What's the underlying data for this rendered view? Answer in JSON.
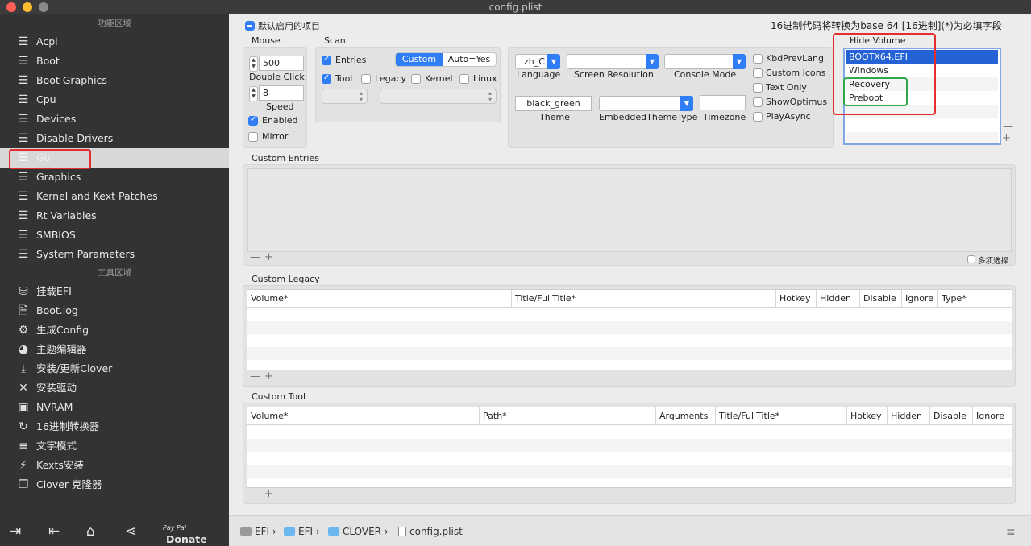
{
  "window": {
    "title": "config.plist"
  },
  "colors": {
    "accent": "#2f7ef6",
    "sidebar_bg": "#333333",
    "highlight_red": "#e52d2d",
    "highlight_green": "#2ea84a"
  },
  "sidebar": {
    "section1": "功能区域",
    "items": [
      {
        "label": "Acpi",
        "icon": "list-icon"
      },
      {
        "label": "Boot",
        "icon": "list-icon"
      },
      {
        "label": "Boot Graphics",
        "icon": "list-icon"
      },
      {
        "label": "Cpu",
        "icon": "list-icon"
      },
      {
        "label": "Devices",
        "icon": "list-icon"
      },
      {
        "label": "Disable Drivers",
        "icon": "list-icon"
      },
      {
        "label": "Gui",
        "icon": "list-icon",
        "selected": true
      },
      {
        "label": "Graphics",
        "icon": "list-icon"
      },
      {
        "label": "Kernel and Kext Patches",
        "icon": "list-icon"
      },
      {
        "label": "Rt Variables",
        "icon": "list-icon"
      },
      {
        "label": "SMBIOS",
        "icon": "list-icon"
      },
      {
        "label": "System Parameters",
        "icon": "list-icon"
      }
    ],
    "section2": "工具区域",
    "tools": [
      {
        "label": "挂载EFI",
        "icon": "disk-icon"
      },
      {
        "label": "Boot.log",
        "icon": "log-icon"
      },
      {
        "label": "生成Config",
        "icon": "gears-icon"
      },
      {
        "label": "主题编辑器",
        "icon": "palette-icon"
      },
      {
        "label": "安装/更新Clover",
        "icon": "download-icon"
      },
      {
        "label": "安装驱动",
        "icon": "tools-icon"
      },
      {
        "label": "NVRAM",
        "icon": "chip-icon"
      },
      {
        "label": "16进制转换器",
        "icon": "refresh-icon"
      },
      {
        "label": "文字模式",
        "icon": "text-icon"
      },
      {
        "label": "Kexts安装",
        "icon": "plug-icon"
      },
      {
        "label": "Clover 克隆器",
        "icon": "copy-icon"
      }
    ],
    "bottom": {
      "paypal": "Pay Pal",
      "donate": "Donate"
    }
  },
  "main": {
    "default_items_label": "默认启用的项目",
    "hint": "16进制代码将转换为base 64 [16进制](*)为必填字段",
    "mouse": {
      "title": "Mouse",
      "double_click_value": "500",
      "double_click_label": "Double Click",
      "speed_value": "8",
      "speed_label": "Speed",
      "enabled_label": "Enabled",
      "mirror_label": "Mirror"
    },
    "scan": {
      "title": "Scan",
      "entries": "Entries",
      "seg_custom": "Custom",
      "seg_auto": "Auto=Yes",
      "tool": "Tool",
      "legacy": "Legacy",
      "kernel": "Kernel",
      "linux": "Linux"
    },
    "gui": {
      "language_value": "zh_C",
      "language_label": "Language",
      "screen_resolution_label": "Screen Resolution",
      "console_mode_label": "Console Mode",
      "theme_value": "black_green",
      "theme_label": "Theme",
      "embedded_theme_label": "EmbeddedThemeType",
      "timezone_label": "Timezone",
      "kbd_prev_lang": "KbdPrevLang",
      "custom_icons": "Custom Icons",
      "text_only": "Text Only",
      "show_optimus": "ShowOptimus",
      "play_async": "PlayAsync"
    },
    "hide_volume": {
      "title": "Hide Volume",
      "items": [
        "BOOTX64.EFI",
        "Windows",
        "Recovery",
        "Preboot"
      ]
    },
    "custom_entries": {
      "title": "Custom Entries",
      "multi_select": "多项选择"
    },
    "custom_legacy": {
      "title": "Custom Legacy",
      "columns": [
        "Volume*",
        "Title/FullTitle*",
        "Hotkey",
        "Hidden",
        "Disable",
        "Ignore",
        "Type*"
      ]
    },
    "custom_tool": {
      "title": "Custom Tool",
      "columns": [
        "Volume*",
        "Path*",
        "Arguments",
        "Title/FullTitle*",
        "Hotkey",
        "Hidden",
        "Disable",
        "Ignore"
      ]
    }
  },
  "footer": {
    "crumbs": [
      "EFI",
      "EFI",
      "CLOVER",
      "config.plist"
    ]
  }
}
